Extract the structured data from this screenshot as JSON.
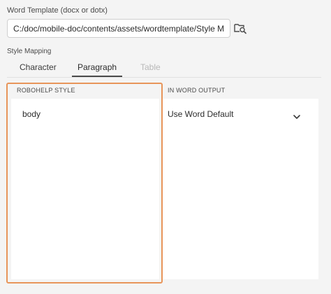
{
  "template_field": {
    "label": "Word Template (docx or dotx)",
    "value": "C:/doc/mobile-doc/contents/assets/wordtemplate/Style Map..."
  },
  "browse_icon": "folder-search-icon",
  "style_mapping": {
    "label": "Style Mapping",
    "tabs": [
      {
        "label": "Character",
        "state": "normal"
      },
      {
        "label": "Paragraph",
        "state": "selected"
      },
      {
        "label": "Table",
        "state": "disabled"
      }
    ]
  },
  "mapping_table": {
    "columns": [
      "ROBOHELP STYLE",
      "IN WORD OUTPUT"
    ],
    "rows": [
      {
        "style": "body",
        "output": "Use Word Default"
      }
    ]
  },
  "dropdown_icon": "chevron-down-icon",
  "colors": {
    "highlight": "#e8955a",
    "background": "#f4f4f4",
    "table_background": "#ffffff",
    "disabled_text": "#b8b8b8"
  }
}
